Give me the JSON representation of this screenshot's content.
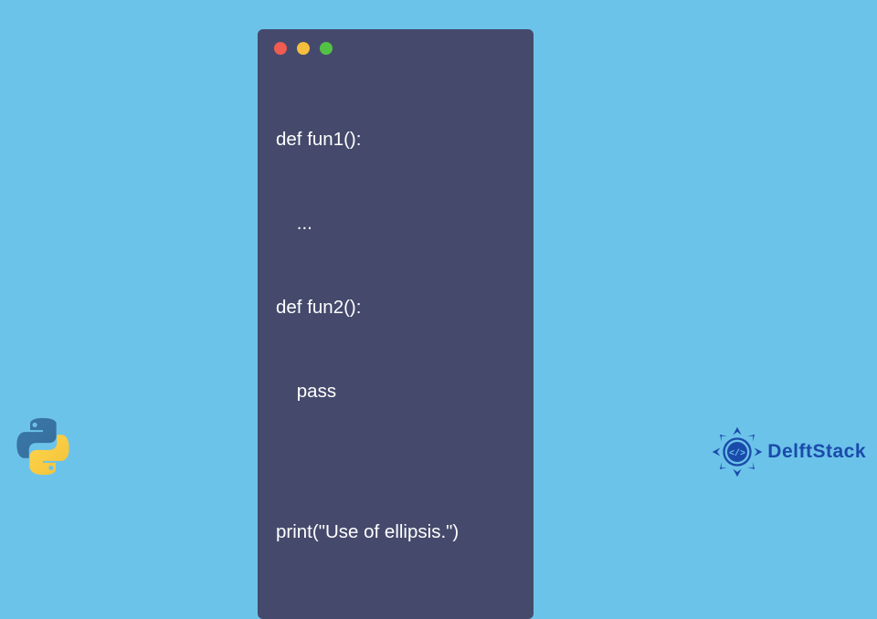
{
  "code": {
    "lines": [
      "def fun1():",
      "    ...",
      "def fun2():",
      "    pass",
      "",
      "print(\"Use of ellipsis.\")"
    ]
  },
  "branding": {
    "name": "DelftStack"
  },
  "colors": {
    "background": "#6cc3ea",
    "window": "#454a6c",
    "dot_red": "#f05b52",
    "dot_yellow": "#f5be3d",
    "dot_green": "#53c244",
    "brand_text": "#1a4baa"
  }
}
